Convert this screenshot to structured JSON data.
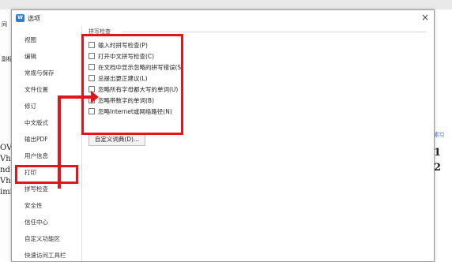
{
  "background": {
    "left_fragments": [
      "间",
      "副标"
    ],
    "doc_fragments": [
      "OV",
      "Vha",
      "nd",
      "Vha",
      "imi"
    ],
    "right_fragments": [
      "索引",
      "1",
      "2"
    ]
  },
  "dialog": {
    "icon_text": "W",
    "title": "选项",
    "close_glyph": "×"
  },
  "sidebar": {
    "items": [
      {
        "label": "视图"
      },
      {
        "label": "编辑"
      },
      {
        "label": "常规与保存"
      },
      {
        "label": "文件位置"
      },
      {
        "label": "修订"
      },
      {
        "label": "中文版式"
      },
      {
        "label": "输出PDF"
      },
      {
        "label": "用户信息"
      },
      {
        "label": "打印"
      },
      {
        "label": "拼写检查"
      },
      {
        "label": "安全性"
      },
      {
        "label": "信任中心"
      },
      {
        "label": "自定义功能区"
      },
      {
        "label": "快速访问工具栏"
      }
    ],
    "selected_index": 9
  },
  "spellcheck": {
    "group_title": "拼写检查",
    "options": [
      {
        "label": "输入时拼写检查(P)",
        "checked": false
      },
      {
        "label": "打开中文拼写检查(C)",
        "checked": false
      },
      {
        "label": "在文档中显示忽略的拼写错误(S)",
        "checked": false
      },
      {
        "label": "总提出更正建议(L)",
        "checked": false
      },
      {
        "label": "忽略所有字母都大写的单词(U)",
        "checked": false
      },
      {
        "label": "忽略带数字的单词(B)",
        "checked": false
      },
      {
        "label": "忽略Internet或网络路径(N)",
        "checked": false
      }
    ],
    "dict_button": "自定义词典(D)..."
  },
  "colors": {
    "annotation": "#e3151a",
    "app_icon": "#2e7cd6"
  }
}
